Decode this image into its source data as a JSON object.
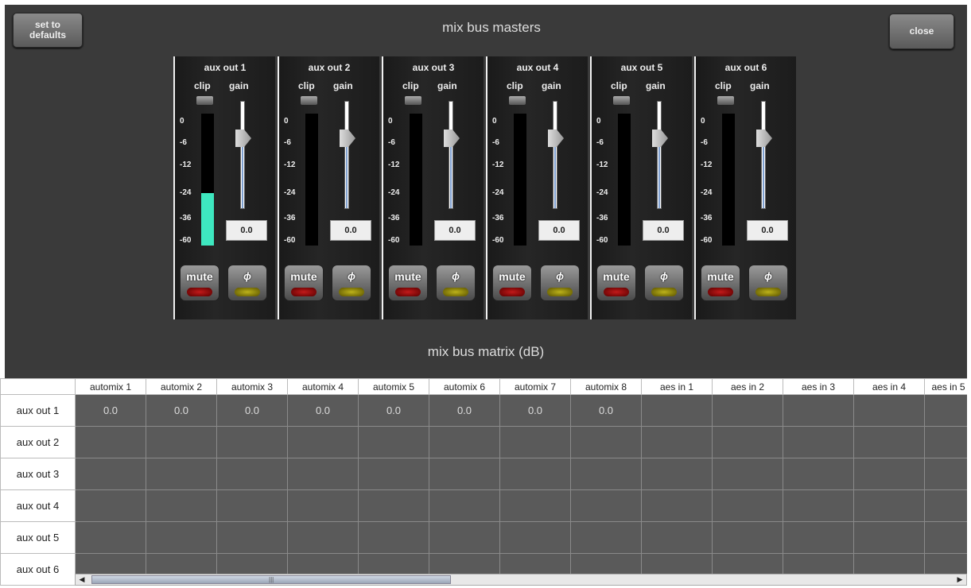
{
  "header": {
    "defaults_label_line1": "set to",
    "defaults_label_line2": "defaults",
    "title": "mix bus masters",
    "close_label": "close"
  },
  "strips": [
    {
      "title": "aux out 1",
      "gain": "0.0",
      "mute": "mute",
      "phase": "ϕ",
      "meter_level_db": -24
    },
    {
      "title": "aux out 2",
      "gain": "0.0",
      "mute": "mute",
      "phase": "ϕ",
      "meter_level_db": null
    },
    {
      "title": "aux out 3",
      "gain": "0.0",
      "mute": "mute",
      "phase": "ϕ",
      "meter_level_db": null
    },
    {
      "title": "aux out 4",
      "gain": "0.0",
      "mute": "mute",
      "phase": "ϕ",
      "meter_level_db": null
    },
    {
      "title": "aux out 5",
      "gain": "0.0",
      "mute": "mute",
      "phase": "ϕ",
      "meter_level_db": null
    },
    {
      "title": "aux out 6",
      "gain": "0.0",
      "mute": "mute",
      "phase": "ϕ",
      "meter_level_db": null
    }
  ],
  "strip_labels": {
    "clip": "clip",
    "gain": "gain"
  },
  "meter_scale": [
    "0",
    "-6",
    "-12",
    "-24",
    "-36",
    "-60"
  ],
  "matrix": {
    "title": "mix bus matrix (dB)",
    "columns": [
      "automix 1",
      "automix 2",
      "automix 3",
      "automix 4",
      "automix 5",
      "automix 6",
      "automix 7",
      "automix 8",
      "aes in 1",
      "aes in 2",
      "aes in 3",
      "aes in 4",
      "aes in 5"
    ],
    "rows": [
      {
        "label": "aux out 1",
        "cells": [
          "0.0",
          "0.0",
          "0.0",
          "0.0",
          "0.0",
          "0.0",
          "0.0",
          "0.0",
          "",
          "",
          "",
          "",
          ""
        ]
      },
      {
        "label": "aux out 2",
        "cells": [
          "",
          "",
          "",
          "",
          "",
          "",
          "",
          "",
          "",
          "",
          "",
          "",
          ""
        ]
      },
      {
        "label": "aux out 3",
        "cells": [
          "",
          "",
          "",
          "",
          "",
          "",
          "",
          "",
          "",
          "",
          "",
          "",
          ""
        ]
      },
      {
        "label": "aux out 4",
        "cells": [
          "",
          "",
          "",
          "",
          "",
          "",
          "",
          "",
          "",
          "",
          "",
          "",
          ""
        ]
      },
      {
        "label": "aux out 5",
        "cells": [
          "",
          "",
          "",
          "",
          "",
          "",
          "",
          "",
          "",
          "",
          "",
          "",
          ""
        ]
      },
      {
        "label": "aux out 6",
        "cells": [
          "",
          "",
          "",
          "",
          "",
          "",
          "",
          "",
          "",
          "",
          "",
          "",
          ""
        ]
      }
    ]
  },
  "colors": {
    "meter_fill": "#3ee8c0",
    "panel_bg": "#3a3a3a",
    "mute_led": "#c21a1a",
    "phase_led": "#bcb21a"
  }
}
